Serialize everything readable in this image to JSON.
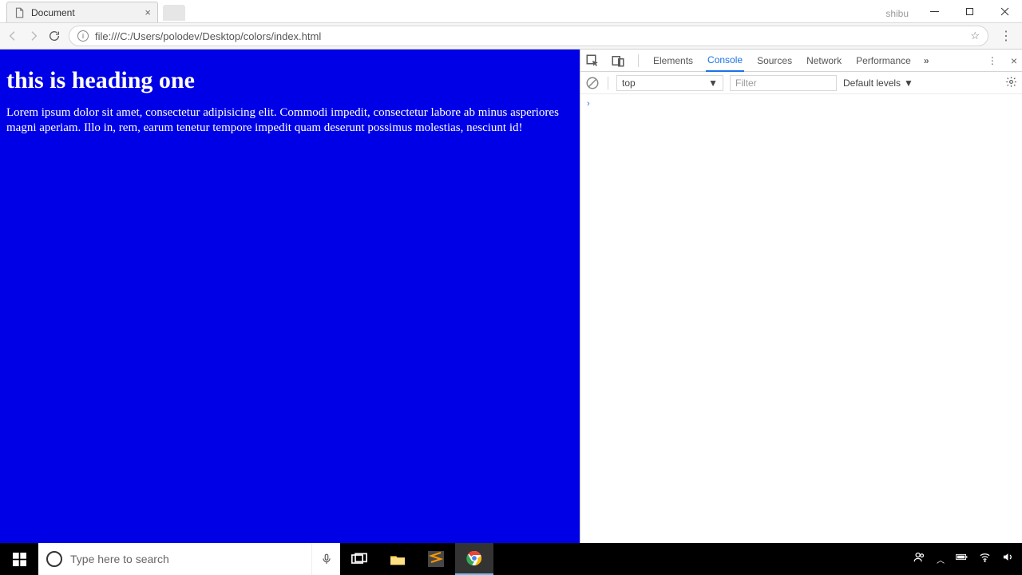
{
  "browser": {
    "tab_title": "Document",
    "user_label": "shibu",
    "url": "file:///C:/Users/polodev/Desktop/colors/index.html"
  },
  "page": {
    "heading": "this is heading one",
    "paragraph": "Lorem ipsum dolor sit amet, consectetur adipisicing elit. Commodi impedit, consectetur labore ab minus asperiores magni aperiam. Illo in, rem, earum tenetur tempore impedit quam deserunt possimus molestias, nesciunt id!",
    "bg_color": "#0000e6"
  },
  "devtools": {
    "tabs": {
      "elements": "Elements",
      "console": "Console",
      "sources": "Sources",
      "network": "Network",
      "performance": "Performance"
    },
    "toolbar": {
      "context": "top",
      "filter_placeholder": "Filter",
      "levels_label": "Default levels"
    }
  },
  "taskbar": {
    "search_placeholder": "Type here to search"
  }
}
